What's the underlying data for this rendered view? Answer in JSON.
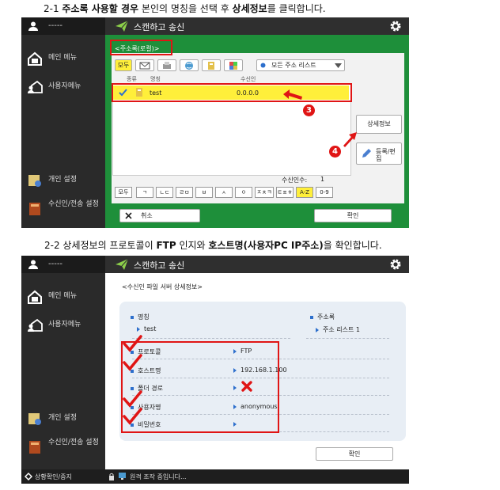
{
  "caption1": {
    "prefix": "2-1 ",
    "b1": "주소록 사용할 경우",
    "mid": " 본인의 명칭을 선택 후 ",
    "b2": "상세정보",
    "suffix": "를 클릭합니다."
  },
  "caption2": {
    "prefix": "2-2 상세정보의 프로토콜이 ",
    "b1": "FTP",
    "mid": " 인지와 ",
    "b2": "호스트명(사용자PC IP주소)",
    "suffix": "을 확인합니다."
  },
  "screen1": {
    "user_label": "-----",
    "title": "스캔하고 송신",
    "sidebar": [
      {
        "label": "메인 메뉴"
      },
      {
        "label": "사용자메뉴"
      },
      {
        "label": "개인 설정"
      },
      {
        "label": "수신인/전송 설정"
      }
    ],
    "address_book_tab": "<주소록(로컬)>",
    "filter_all": "모두",
    "list_dropdown": "모든 주소 리스트",
    "col_type": "종류",
    "col_name": "명칭",
    "col_dest": "수신인",
    "row": {
      "name": "test",
      "dest": "0.0.0.0"
    },
    "details_button": "상세정보",
    "register_button": "등록/편집",
    "dest_count_label": "수신인수:",
    "dest_count": "1",
    "letters": [
      "모두",
      "ㄱ",
      "ㄴㄷ",
      "ㄹㅁ",
      "ㅂ",
      "ㅅ",
      "ㅇ",
      "ㅈㅊㅋ",
      "ㅌㅍㅎ",
      "A-Z",
      "0-9"
    ],
    "cancel_button": "취소",
    "ok_button": "확인",
    "markers": [
      "3",
      "4"
    ]
  },
  "screen2": {
    "user_label": "-----",
    "title": "스캔하고 송신",
    "sidebar": [
      {
        "label": "메인 메뉴"
      },
      {
        "label": "사용자메뉴"
      },
      {
        "label": "개인 설정"
      },
      {
        "label": "수신인/전송 설정"
      }
    ],
    "panel_title": "<수신인 파일 서버 상세정보>",
    "name_label": "명칭",
    "name_value": "test",
    "addrbook_label": "주소록",
    "addrbook_value": "주소 리스트 1",
    "fields": [
      {
        "label": "프로토콜",
        "value": "FTP"
      },
      {
        "label": "호스트명",
        "value": "192.168.1.100"
      },
      {
        "label": "폴더 경로",
        "value": ""
      },
      {
        "label": "사용자명",
        "value": "anonymous"
      },
      {
        "label": "비밀번호",
        "value": ""
      }
    ],
    "ok_button": "확인",
    "status_left": "상황확인/중지",
    "status_right": "원격 조작 중입니다..."
  },
  "colors": {
    "accent_green": "#1e8f3a",
    "highlight_yellow": "#ffef3a",
    "annotation_red": "#e01515",
    "sidebar_dark": "#2a2a2a"
  }
}
